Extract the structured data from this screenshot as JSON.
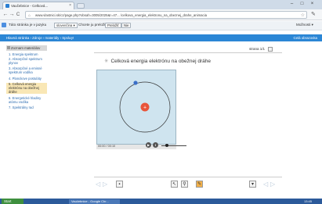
{
  "browser": {
    "tab_title": "Vaučebnice - Celková...",
    "close_symbol": "×",
    "window_controls": [
      "–",
      "□",
      "×"
    ],
    "url": "www.vlastnici.sk/cz/page.php?obsah=3005/2025&r=47... /celkova_energia_elektronu_na_obeznej_drahe_animacia",
    "nav_back": "←",
    "nav_forward": "→",
    "nav_reload": "C",
    "nav_home": "⌂",
    "star": "☆",
    "wrench": "✎"
  },
  "translate_bar": {
    "prefix": "Táto stránka je v jazyku",
    "source_lang": "slovenčina ▾",
    "question": "Chcete ju preložiť?",
    "translate_button": "Preložiť",
    "no_button": "Nie",
    "options": "Možnosti ▾"
  },
  "site": {
    "breadcrumb": "Hlavná stránka › Zdroje › materiály › Správy!",
    "right_link": "Celá obrazovka"
  },
  "sidebar": {
    "heading": "Zoznam materiálov",
    "items": [
      {
        "label": "1. Energia spektrum"
      },
      {
        "label": "2. Absorpčné spektrum plynov"
      },
      {
        "label": "3. Absorpčné a emisné spektrum vodíka"
      },
      {
        "label": "4. Planckove postuláty"
      },
      {
        "label": "5. Celková energia elektrónu na obežnej dráhe"
      },
      {
        "label": "6. Energetické hladiny atómu vodíka"
      },
      {
        "label": "7. Spektrálny rad"
      }
    ]
  },
  "slide": {
    "page_label": "strana",
    "page_value": "1/1",
    "title": "Celková energia elektrónu na obežnej dráhe",
    "time": "00:00 / 00:10"
  },
  "taskbar": {
    "start": "Start",
    "item": "Vaučebnice - Google Chr...",
    "clock": "13:45"
  },
  "colors": {
    "site_bar": "#2b86d5",
    "active_item": "#f9e7b5",
    "sim_bg": "#cfe4ef",
    "nucleus": "#e8543a"
  }
}
